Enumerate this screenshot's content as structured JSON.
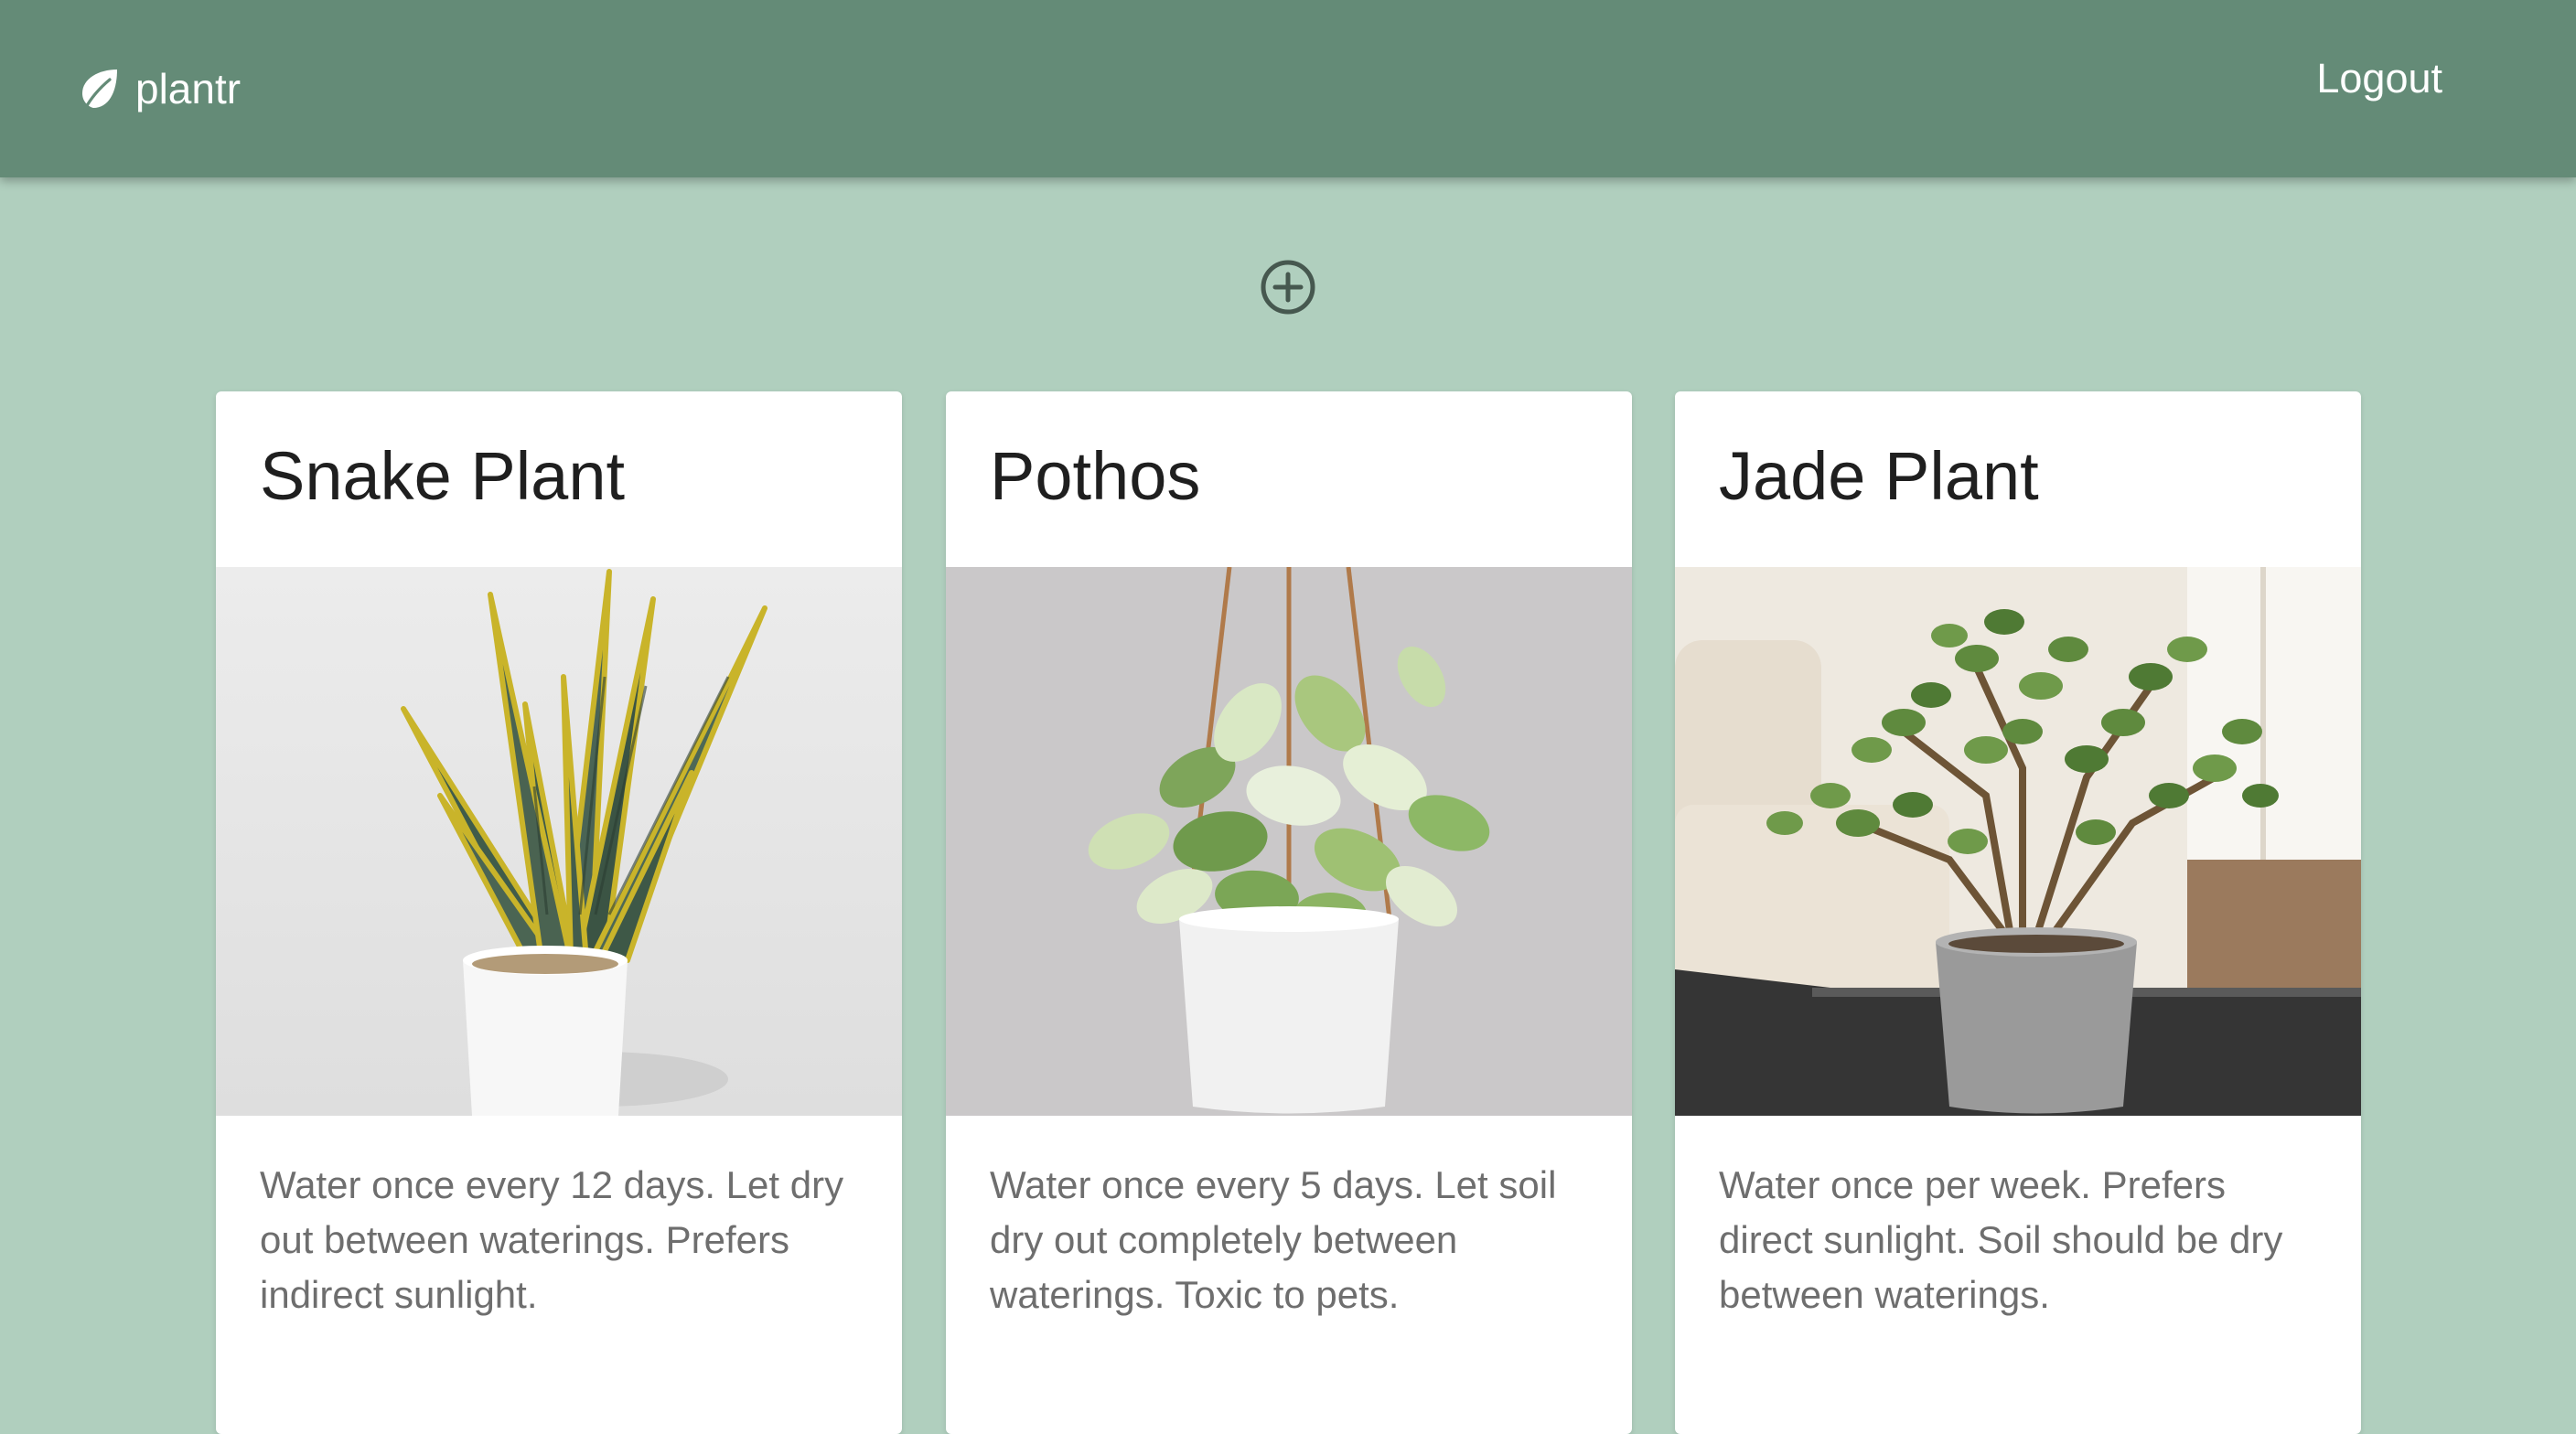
{
  "app": {
    "brand": "plantr",
    "logout_label": "Logout",
    "colors": {
      "navbar": "#648b77",
      "background": "#b0cfbe",
      "card": "#ffffff"
    }
  },
  "actions": {
    "add_icon": "plus-circle-icon"
  },
  "plants": [
    {
      "name": "Snake Plant",
      "description": "Water once every 12 days. Let dry out between waterings. Prefers indirect sunlight."
    },
    {
      "name": "Pothos",
      "description": "Water once every 5 days. Let soil dry out completely between waterings. Toxic to pets."
    },
    {
      "name": "Jade Plant",
      "description": "Water once per week. Prefers direct sunlight. Soil should be dry between waterings."
    }
  ]
}
